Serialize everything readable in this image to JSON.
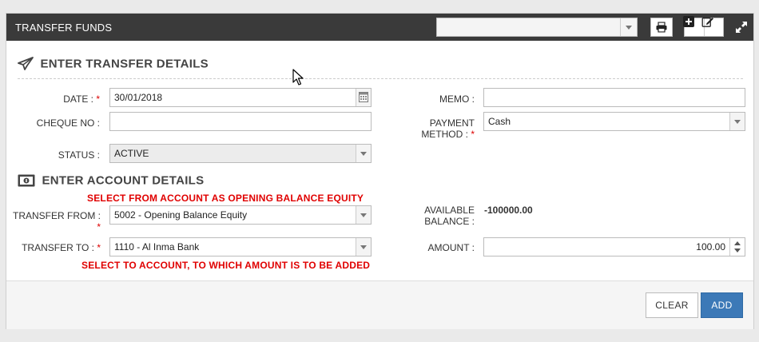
{
  "header": {
    "title": "TRANSFER FUNDS",
    "select_value": "",
    "icons": [
      "print-icon",
      "plus-square-icon",
      "edit-icon",
      "expand-icon"
    ]
  },
  "transfer_section": {
    "title": "ENTER TRANSFER DETAILS",
    "icon": "paper-plane-icon",
    "date": {
      "label": "DATE :",
      "value": "30/01/2018"
    },
    "cheque_no": {
      "label": "CHEQUE NO :",
      "value": ""
    },
    "status": {
      "label": "STATUS :",
      "value": "ACTIVE"
    },
    "memo": {
      "label": "MEMO :",
      "value": ""
    },
    "payment_method": {
      "label_line1": "PAYMENT",
      "label_line2": "METHOD :",
      "value": "Cash"
    }
  },
  "account_section": {
    "title": "ENTER ACCOUNT DETAILS",
    "icon": "money-icon",
    "note_from": "SELECT FROM ACCOUNT AS OPENING BALANCE EQUITY",
    "note_to": "SELECT TO ACCOUNT, TO WHICH AMOUNT IS TO BE ADDED",
    "transfer_from": {
      "label": "TRANSFER FROM :",
      "value": "5002 - Opening Balance Equity"
    },
    "transfer_to": {
      "label": "TRANSFER TO :",
      "value": "1110 - Al Inma Bank"
    },
    "available_balance": {
      "label_line1": "AVAILABLE",
      "label_line2": "BALANCE :",
      "value": "-100000.00"
    },
    "amount": {
      "label": "AMOUNT :",
      "value": "100.00"
    }
  },
  "required_mark": "*",
  "footer": {
    "clear_label": "CLEAR",
    "add_label": "ADD"
  },
  "colors": {
    "header_bg": "#3a3a3a",
    "primary_button": "#3c79b7",
    "required": "#dd0000",
    "annotation": "#e00000"
  }
}
